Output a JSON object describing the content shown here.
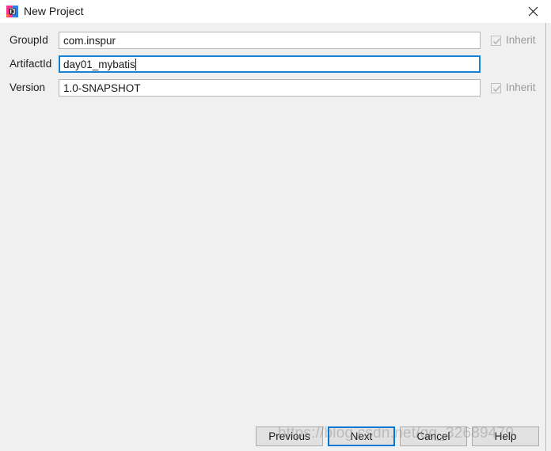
{
  "window": {
    "title": "New Project",
    "icon": "intellij-idea-icon",
    "close_label": "✕"
  },
  "form": {
    "rows": [
      {
        "label": "GroupId",
        "value": "com.inspur",
        "placeholder": "",
        "focused": false,
        "inherit": {
          "label": "Inherit",
          "checked": true,
          "enabled": false,
          "visible": true
        }
      },
      {
        "label": "ArtifactId",
        "value": "day01_mybatis",
        "placeholder": "",
        "focused": true,
        "inherit": {
          "label": "",
          "checked": false,
          "enabled": false,
          "visible": false
        }
      },
      {
        "label": "Version",
        "value": "1.0-SNAPSHOT",
        "placeholder": "",
        "focused": false,
        "inherit": {
          "label": "Inherit",
          "checked": true,
          "enabled": false,
          "visible": true
        }
      }
    ]
  },
  "buttons": {
    "previous": "Previous",
    "next": "Next",
    "cancel": "Cancel",
    "help": "Help"
  },
  "watermark": {
    "text": "https://blog.csdn.net/qq_32689479"
  },
  "colors": {
    "dialog_background": "#f0f0f0",
    "titlebar_background": "#ffffff",
    "field_background": "#ffffff",
    "field_border": "#b5b5b5",
    "focus_border": "#1981d2",
    "default_button_border": "#0078d7",
    "button_background": "#e1e1e1",
    "disabled_text": "#9a9a9a"
  }
}
